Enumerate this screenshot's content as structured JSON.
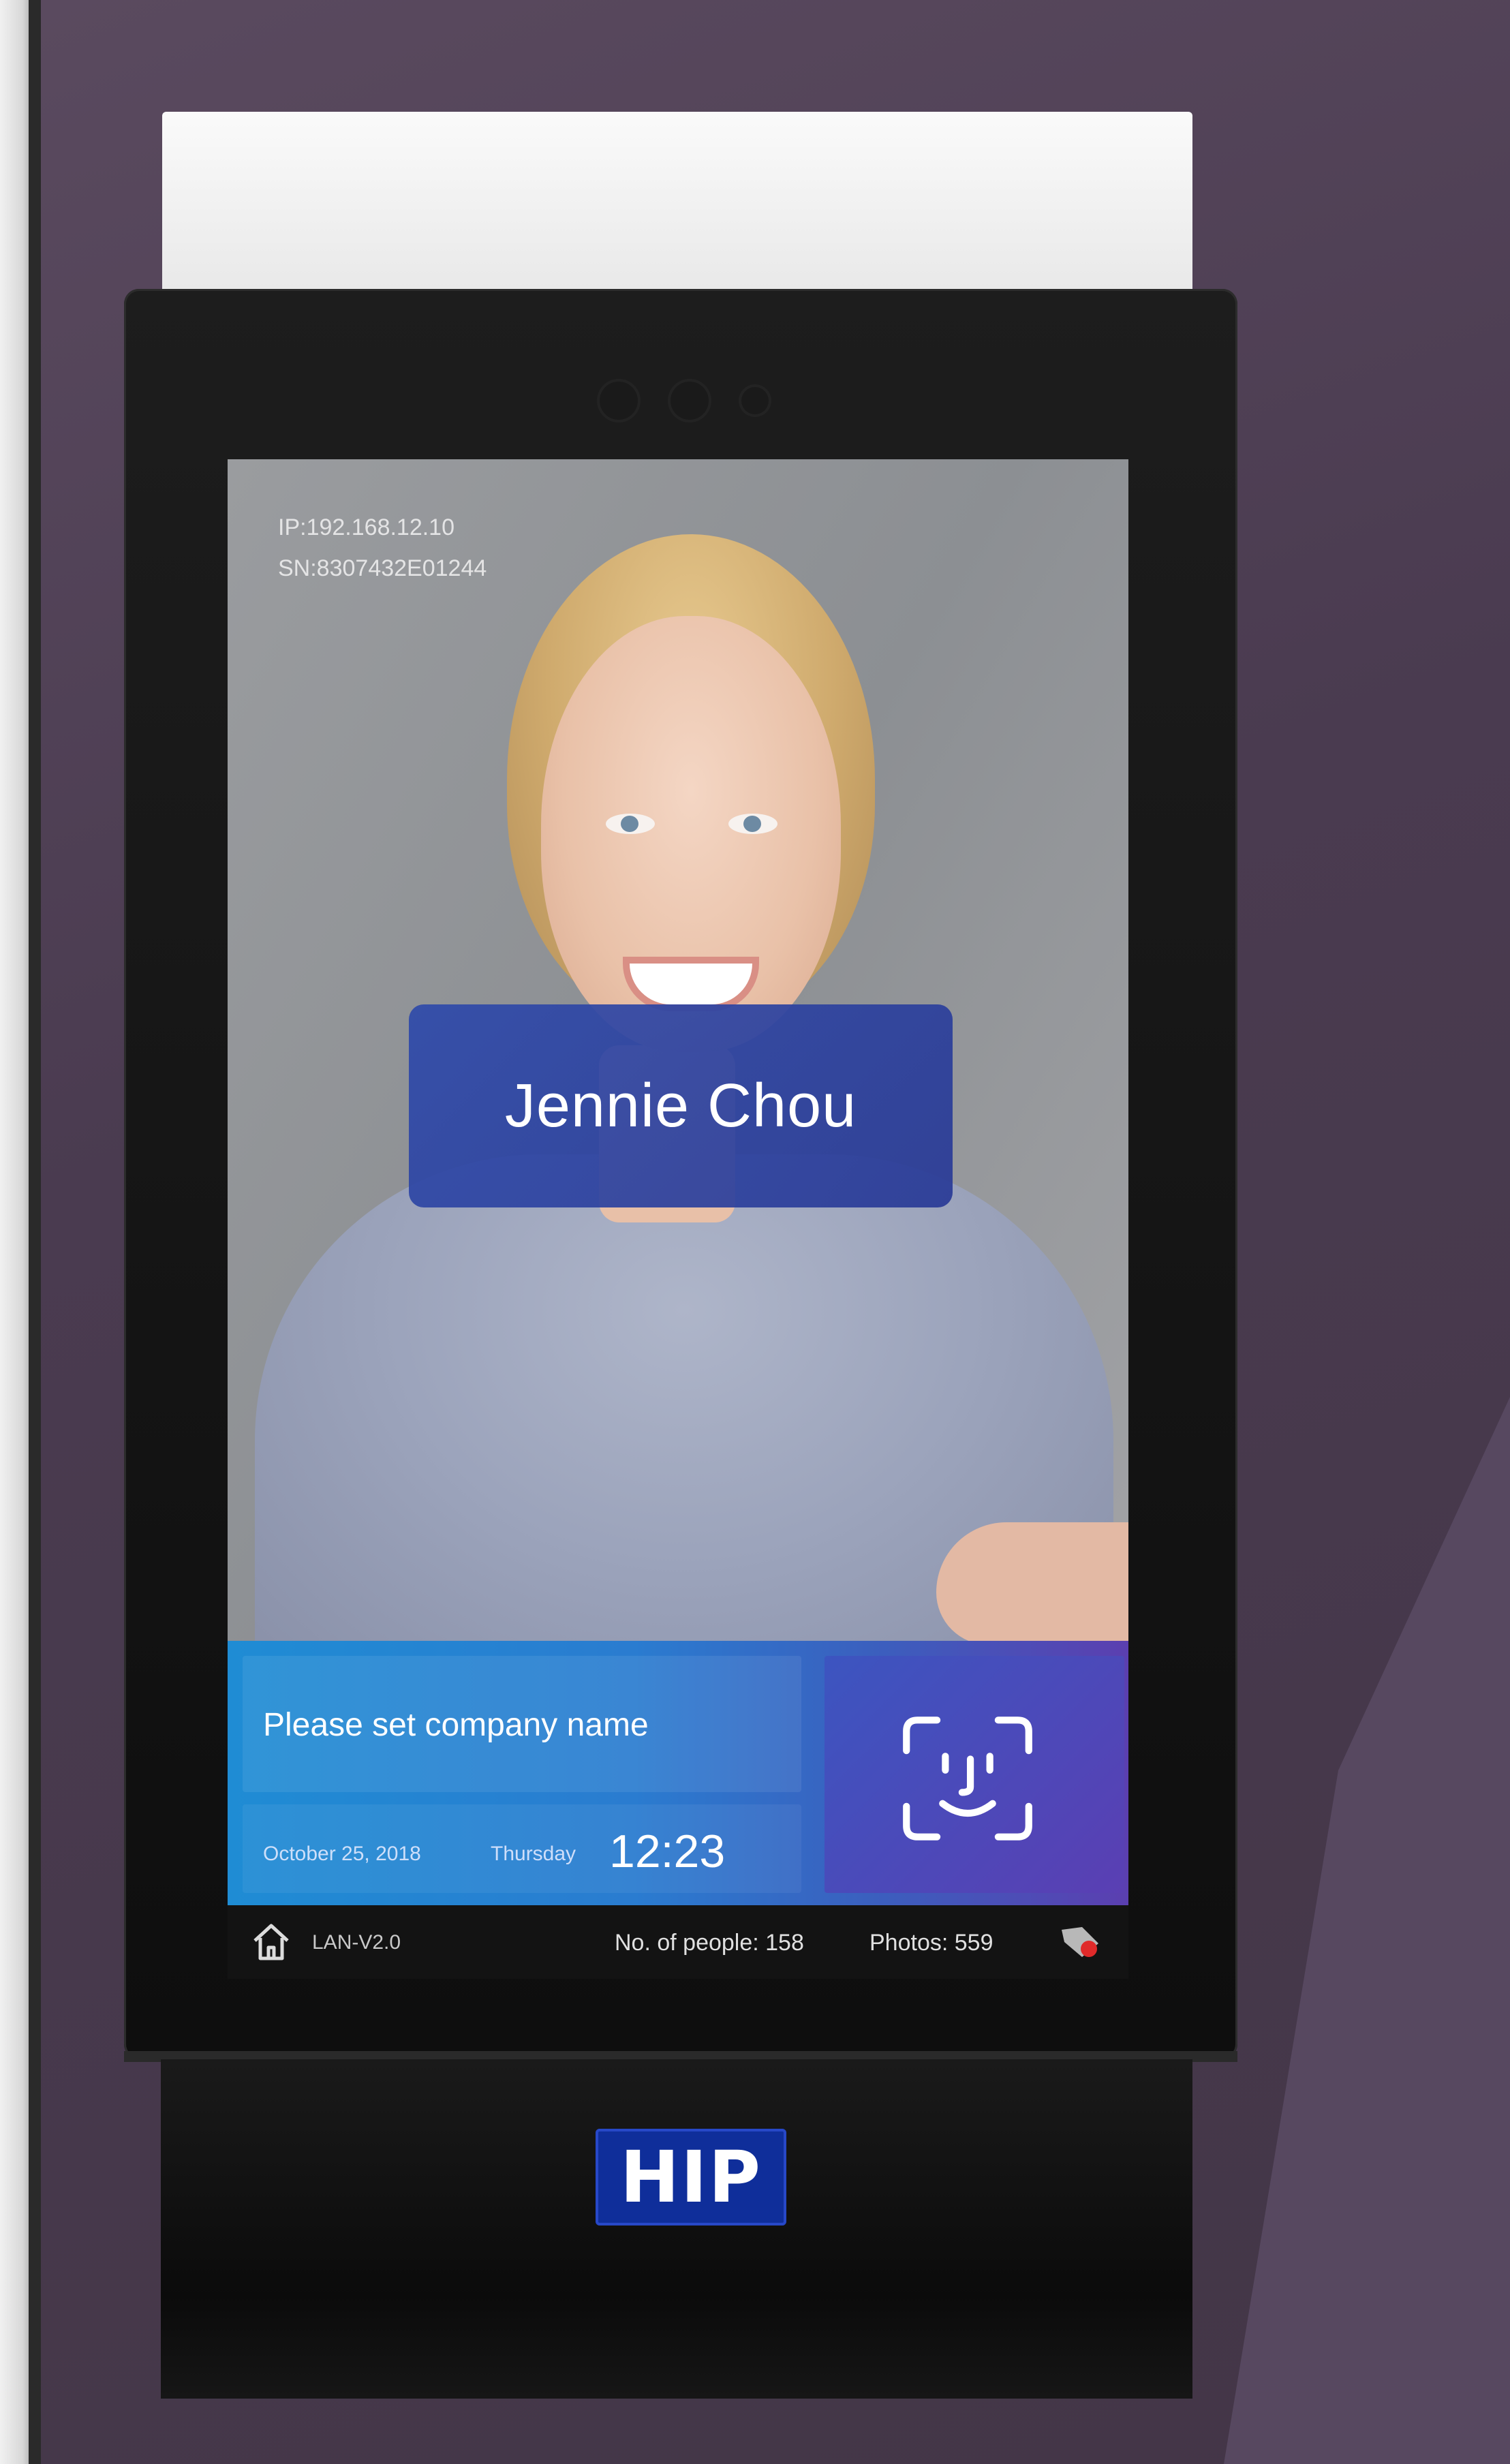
{
  "device": {
    "ip_line": "IP:192.168.12.10",
    "sn_line": "SN:8307432E01244",
    "recognized_name": "Jennie Chou",
    "company_name": "Please set company name",
    "date": "October 25, 2018",
    "weekday": "Thursday",
    "time": "12:23",
    "network": "LAN-V2.0",
    "people_count": "No. of people: 158",
    "photos_count": "Photos: 559",
    "brand_logo": "HIP"
  },
  "icons": {
    "face_scan": "face-scan-icon",
    "home": "home-icon",
    "status_tag": "tag-icon"
  },
  "colors": {
    "background": "#4b3d52",
    "panel_start": "#1f8cd4",
    "panel_end": "#5b3fb0",
    "name_card": "#2f4aaa",
    "logo_blue": "#0f2e9a"
  }
}
